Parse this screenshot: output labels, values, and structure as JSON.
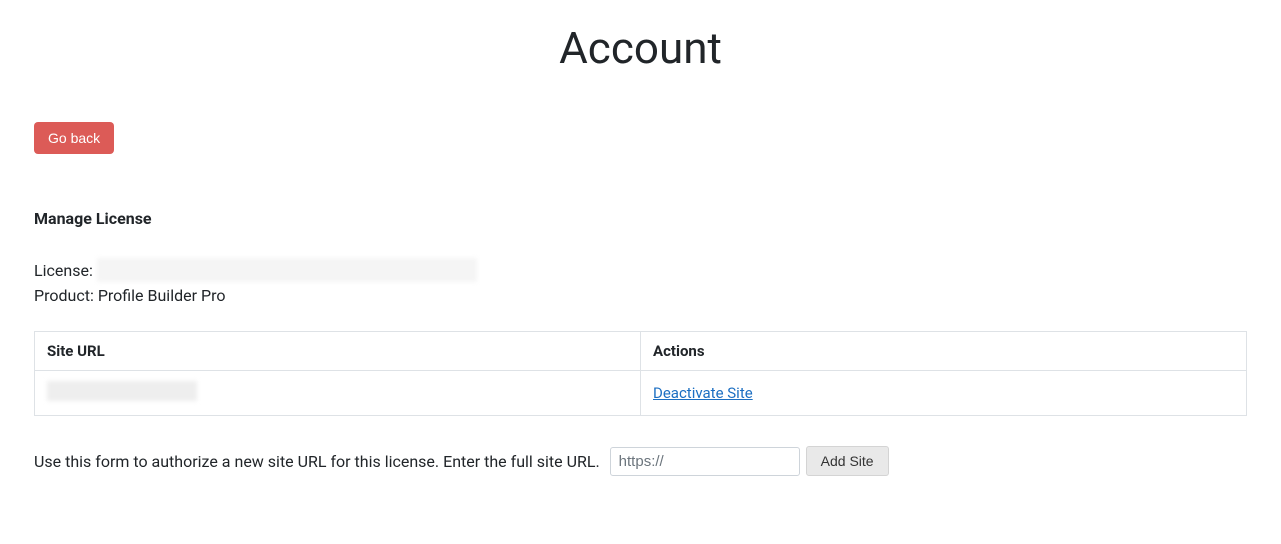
{
  "page": {
    "title": "Account"
  },
  "buttons": {
    "go_back": "Go back",
    "add_site": "Add Site"
  },
  "license_section": {
    "heading": "Manage License",
    "license_label": "License:",
    "license_value": "",
    "product_label": "Product:",
    "product_value": "Profile Builder Pro"
  },
  "table": {
    "headers": {
      "site_url": "Site URL",
      "actions": "Actions"
    },
    "rows": [
      {
        "site_url": "",
        "action_label": "Deactivate Site"
      }
    ]
  },
  "add_form": {
    "help_text": "Use this form to authorize a new site URL for this license. Enter the full site URL.",
    "placeholder": "https://"
  }
}
